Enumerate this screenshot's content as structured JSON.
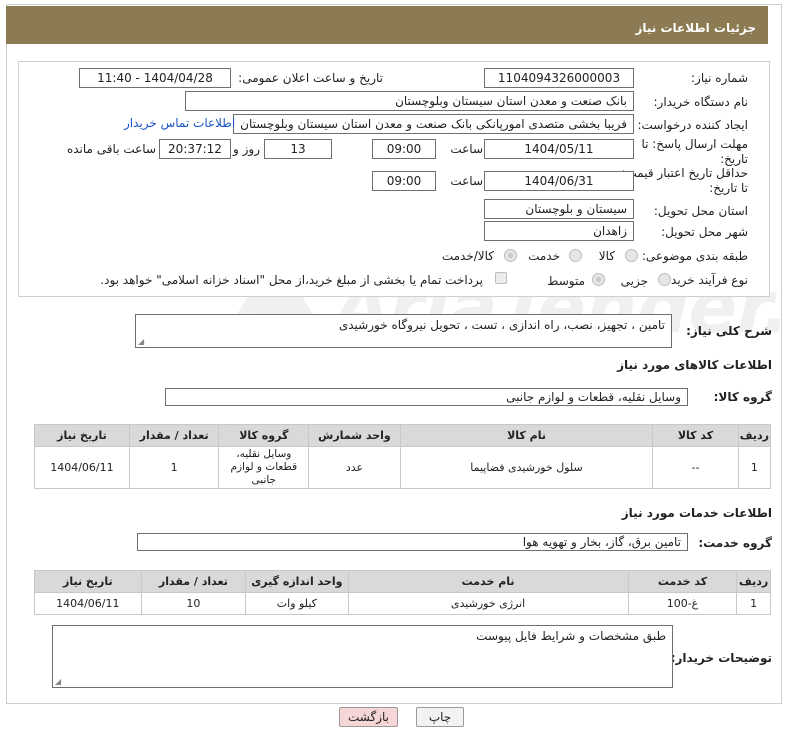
{
  "header": {
    "title": "جزئیات اطلاعات نیاز"
  },
  "watermark": {
    "text": "AriaTender.net"
  },
  "form": {
    "need_number": {
      "label": "شماره نیاز:",
      "value": "1104094326000003"
    },
    "announce_datetime": {
      "label": "تاریخ و ساعت اعلان عمومی:",
      "value": "1404/04/28 - 11:40"
    },
    "buyer_org": {
      "label": "نام دستگاه خریدار:",
      "value": "بانک صنعت و معدن استان سیستان وبلوچستان"
    },
    "creator": {
      "label": "ایجاد کننده درخواست:",
      "value": "فریبا بخشی متصدی امورپانکی بانک صنعت و معدن استان سیستان وبلوچستان",
      "link": "اطلاعات تماس خریدار"
    },
    "deadline": {
      "label": "مهلت ارسال پاسخ: تا تاریخ:",
      "date": "1404/05/11",
      "time_label": "ساعت",
      "time": "09:00",
      "days": "13",
      "days_label": "روز و",
      "remaining": "20:37:12",
      "remaining_label": "ساعت باقی مانده"
    },
    "price_validity": {
      "label": "حداقل تاریخ اعتبار قیمت: تا تاریخ:",
      "date": "1404/06/31",
      "time_label": "ساعت",
      "time": "09:00"
    },
    "province": {
      "label": "استان محل تحویل:",
      "value": "سیستان و بلوچستان"
    },
    "city": {
      "label": "شهر محل تحویل:",
      "value": "زاهدان"
    },
    "category": {
      "label": "طبقه بندی موضوعی:",
      "options": [
        "کالا",
        "خدمت",
        "کالا/خدمت"
      ],
      "selected": "کالا/خدمت"
    },
    "process": {
      "label": "نوع فرآیند خرید :",
      "options": [
        "جزیی",
        "متوسط"
      ],
      "selected": "متوسط",
      "treasury_note": "پرداخت تمام یا بخشی از مبلغ خرید،از محل \"اسناد خزانه اسلامی\" خواهد بود."
    }
  },
  "description": {
    "label": "شرح کلی نیاز:",
    "value": "تامین ، تجهیز، نصب، راه اندازی ، تست ، تحویل نیروگاه خورشیدی"
  },
  "goods": {
    "section_title": "اطلاعات کالاهای مورد نیاز",
    "group_label": "گروه کالا:",
    "group_value": "وسایل نقلیه، قطعات و لوازم جانبی",
    "columns": [
      "ردیف",
      "کد کالا",
      "نام کالا",
      "واحد شمارش",
      "گروه کالا",
      "تعداد / مقدار",
      "تاریخ نیاز"
    ],
    "rows": [
      [
        "1",
        "--",
        "سلول خورشیدی فضاپیما",
        "عدد",
        "وسایل نقلیه، قطعات و لوازم جانبی",
        "1",
        "1404/06/11"
      ]
    ]
  },
  "services": {
    "section_title": "اطلاعات خدمات مورد نیاز",
    "group_label": "گروه خدمت:",
    "group_value": "تامین برق، گاز، بخار و تهویه هوا",
    "columns": [
      "ردیف",
      "کد خدمت",
      "نام خدمت",
      "واحد اندازه گیری",
      "تعداد / مقدار",
      "تاریخ نیاز"
    ],
    "rows": [
      [
        "1",
        "غ-100",
        "انرژی خورشیدی",
        "کیلو وات",
        "10",
        "1404/06/11"
      ]
    ]
  },
  "buyer_notes": {
    "label": "توضیحات خریدار:",
    "value": "طبق مشخصات و شرایط فایل پیوست"
  },
  "buttons": {
    "print": "چاپ",
    "back": "بازگشت"
  }
}
